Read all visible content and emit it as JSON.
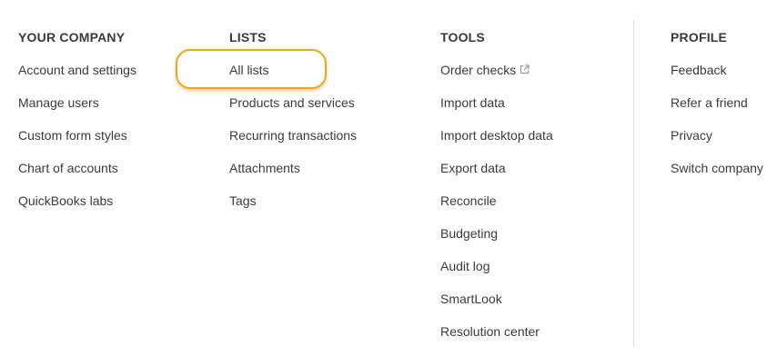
{
  "columns": {
    "company": {
      "heading": "YOUR COMPANY",
      "items": [
        {
          "label": "Account and settings"
        },
        {
          "label": "Manage users"
        },
        {
          "label": "Custom form styles"
        },
        {
          "label": "Chart of accounts"
        },
        {
          "label": "QuickBooks labs"
        }
      ]
    },
    "lists": {
      "heading": "LISTS",
      "items": [
        {
          "label": "All lists"
        },
        {
          "label": "Products and services"
        },
        {
          "label": "Recurring transactions"
        },
        {
          "label": "Attachments"
        },
        {
          "label": "Tags"
        }
      ]
    },
    "tools": {
      "heading": "TOOLS",
      "items": [
        {
          "label": "Order checks",
          "icon": "external-link-icon"
        },
        {
          "label": "Import data"
        },
        {
          "label": "Import desktop data"
        },
        {
          "label": "Export data"
        },
        {
          "label": "Reconcile"
        },
        {
          "label": "Budgeting"
        },
        {
          "label": "Audit log"
        },
        {
          "label": "SmartLook"
        },
        {
          "label": "Resolution center"
        }
      ]
    },
    "profile": {
      "heading": "PROFILE",
      "items": [
        {
          "label": "Feedback"
        },
        {
          "label": "Refer a friend"
        },
        {
          "label": "Privacy"
        },
        {
          "label": "Switch company"
        }
      ]
    }
  },
  "highlight_color": "#f2a51c",
  "text_color": "#393a3d",
  "divider_color": "#dcdcdc"
}
